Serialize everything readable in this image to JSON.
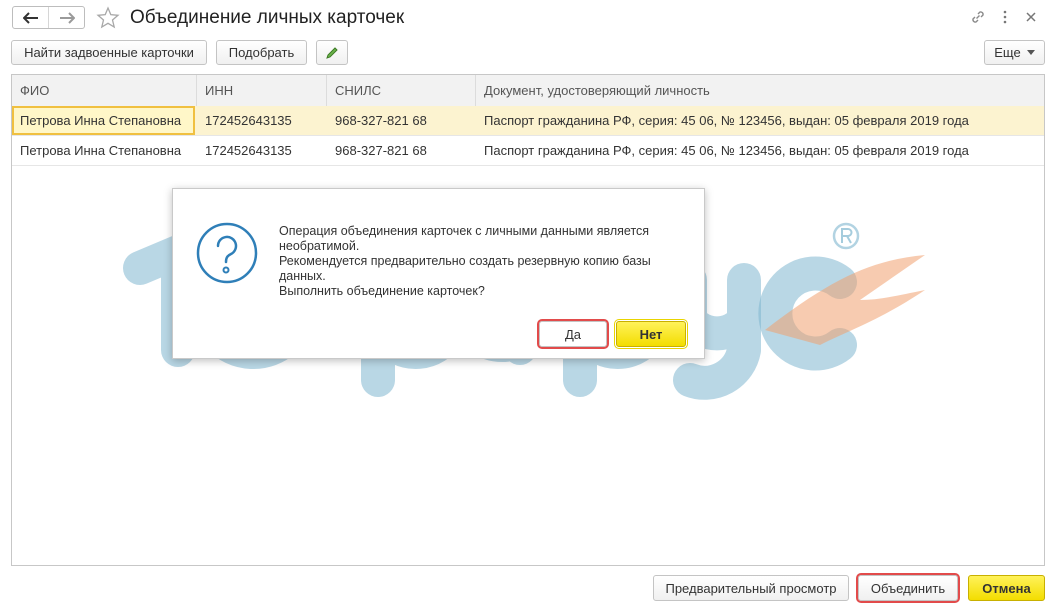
{
  "window": {
    "title": "Объединение личных карточек"
  },
  "toolbar": {
    "find_label": "Найти задвоенные карточки",
    "pick_label": "Подобрать",
    "more_label": "Еще"
  },
  "table": {
    "columns": [
      "ФИО",
      "ИНН",
      "СНИЛС",
      "Документ, удостоверяющий личность"
    ],
    "rows": [
      [
        "Петрова Инна Степановна",
        "172452643135",
        "968-327-821 68",
        "Паспорт гражданина РФ, серия: 45 06, № 123456, выдан: 05 февраля 2019 года"
      ],
      [
        "Петрова Инна Степановна",
        "172452643135",
        "968-327-821 68",
        "Паспорт гражданина РФ, серия: 45 06, № 123456, выдан: 05 февраля 2019 года"
      ]
    ]
  },
  "dialog": {
    "lines": [
      "Операция объединения карточек с личными данными является",
      "необратимой.",
      "Рекомендуется предварительно создать резервную копию базы",
      "данных.",
      "Выполнить объединение карточек?"
    ],
    "yes_label": "Да",
    "no_label": "Нет"
  },
  "footer": {
    "preview_label": "Предварительный просмотр",
    "merge_label": "Объединить",
    "cancel_label": "Отмена"
  },
  "colors": {
    "accent_yellow": "#f7e21a",
    "highlight_red": "#e24b4b",
    "selection": "#fcf3d0"
  }
}
